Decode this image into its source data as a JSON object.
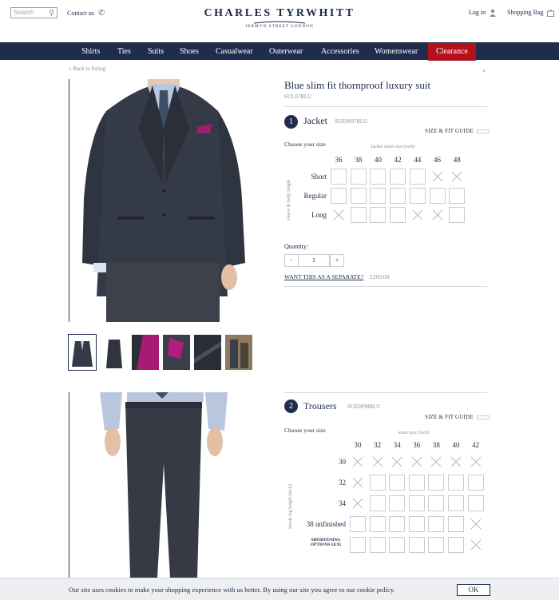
{
  "header": {
    "search_placeholder": "Search",
    "contact_label": "Contact us",
    "brand_main": "CHARLES TYRWHITT",
    "brand_sub": "JERMYN STREET LONDON",
    "login_label": "Log in",
    "bag_label": "Shopping Bag"
  },
  "nav": {
    "items": [
      "Shirts",
      "Ties",
      "Suits",
      "Shoes",
      "Casualwear",
      "Outerwear",
      "Accessories",
      "Womenswear"
    ],
    "clearance": "Clearance"
  },
  "breadcrumb": {
    "back_label": "Back to listing"
  },
  "product": {
    "title": "Blue slim fit thornproof luxury suit",
    "code": "SUL07BLU"
  },
  "jacket": {
    "step": "1",
    "title": "Jacket",
    "code": "SUE0097BLU",
    "size_guide": "SIZE & FIT GUIDE",
    "choose_label": "Choose your size",
    "col_axis_label": "Jacket chest size (inch)",
    "row_axis_label": "sleeve & body length",
    "columns": [
      "36",
      "38",
      "40",
      "42",
      "44",
      "46",
      "48"
    ],
    "rows": [
      {
        "label": "Short",
        "cells": [
          "box",
          "box",
          "box",
          "box",
          "box",
          "x",
          "x"
        ]
      },
      {
        "label": "Regular",
        "cells": [
          "box",
          "box",
          "box",
          "box",
          "box",
          "box",
          "box"
        ]
      },
      {
        "label": "Long",
        "cells": [
          "x",
          "box",
          "box",
          "box",
          "x",
          "x",
          "box"
        ]
      }
    ]
  },
  "quantity": {
    "label": "Quantity:",
    "minus": "-",
    "value": "1",
    "plus": "+"
  },
  "separate": {
    "label": "WANT THIS AS A SEPARATE?",
    "price": "£269.00"
  },
  "trousers": {
    "step": "2",
    "title": "Trousers",
    "code": "SUE0098BLU",
    "size_guide": "SIZE & FIT GUIDE",
    "choose_label": "Choose your size",
    "col_axis_label": "waist size (inch)",
    "row_axis_label": "Inside leg length (inch)",
    "columns": [
      "30",
      "32",
      "34",
      "36",
      "38",
      "40",
      "42"
    ],
    "rows": [
      {
        "label": "30",
        "cells": [
          "x",
          "x",
          "x",
          "x",
          "x",
          "x",
          "x"
        ]
      },
      {
        "label": "32",
        "cells": [
          "x",
          "box",
          "box",
          "box",
          "box",
          "box",
          "box"
        ]
      },
      {
        "label": "34",
        "cells": [
          "x",
          "box",
          "box",
          "box",
          "box",
          "box",
          "box"
        ]
      },
      {
        "label": "38 unfinished",
        "cells": [
          "box",
          "box",
          "box",
          "box",
          "box",
          "box",
          "x"
        ]
      },
      {
        "label": "SHORTENING OPTIONS £8.95",
        "cells": [
          "box",
          "box",
          "box",
          "box",
          "box",
          "box",
          "x"
        ]
      }
    ]
  },
  "cookie": {
    "text": "Our site uses cookies to make your shopping experience with us better. By using our site you agree to our cookie policy.",
    "ok_label": "OK"
  },
  "colors": {
    "navy": "#1f2c4e",
    "clearance_red": "#b3121d",
    "muted": "#8a90a0"
  }
}
